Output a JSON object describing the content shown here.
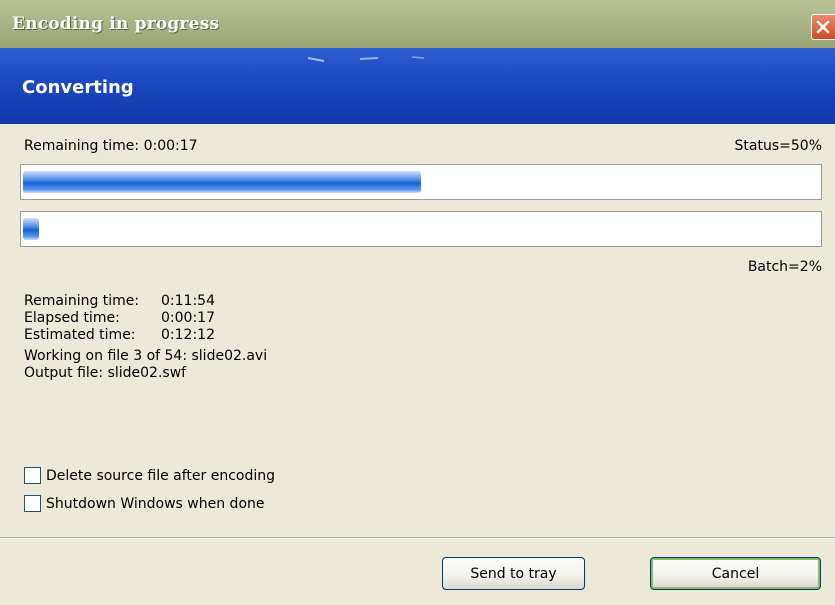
{
  "window": {
    "title": "Encoding in progress",
    "close_icon": "close-icon"
  },
  "header": {
    "title": "Converting"
  },
  "file_progress": {
    "remaining_label": "Remaining time: 0:00:17",
    "status_label": "Status=50%",
    "percent": 50
  },
  "batch_progress": {
    "percent": 2,
    "label": "Batch=2%"
  },
  "stats": {
    "remaining_key": "Remaining time:",
    "remaining_value": "0:11:54",
    "elapsed_key": "Elapsed time:",
    "elapsed_value": "0:00:17",
    "estimated_key": "Estimated time:",
    "estimated_value": "0:12:12",
    "working_on": "Working on file 3 of 54: slide02.avi",
    "output_file": "Output file: slide02.swf"
  },
  "options": {
    "delete_source": {
      "label": "Delete source file after encoding",
      "checked": false
    },
    "shutdown": {
      "label": "Shutdown Windows when done",
      "checked": false
    }
  },
  "buttons": {
    "send_to_tray": "Send to tray",
    "cancel": "Cancel"
  },
  "colors": {
    "title_bar": "#a9b487",
    "header_band": "#1d4cc4",
    "progress_fill": "#1a5fd6",
    "close_button": "#d24a26"
  }
}
